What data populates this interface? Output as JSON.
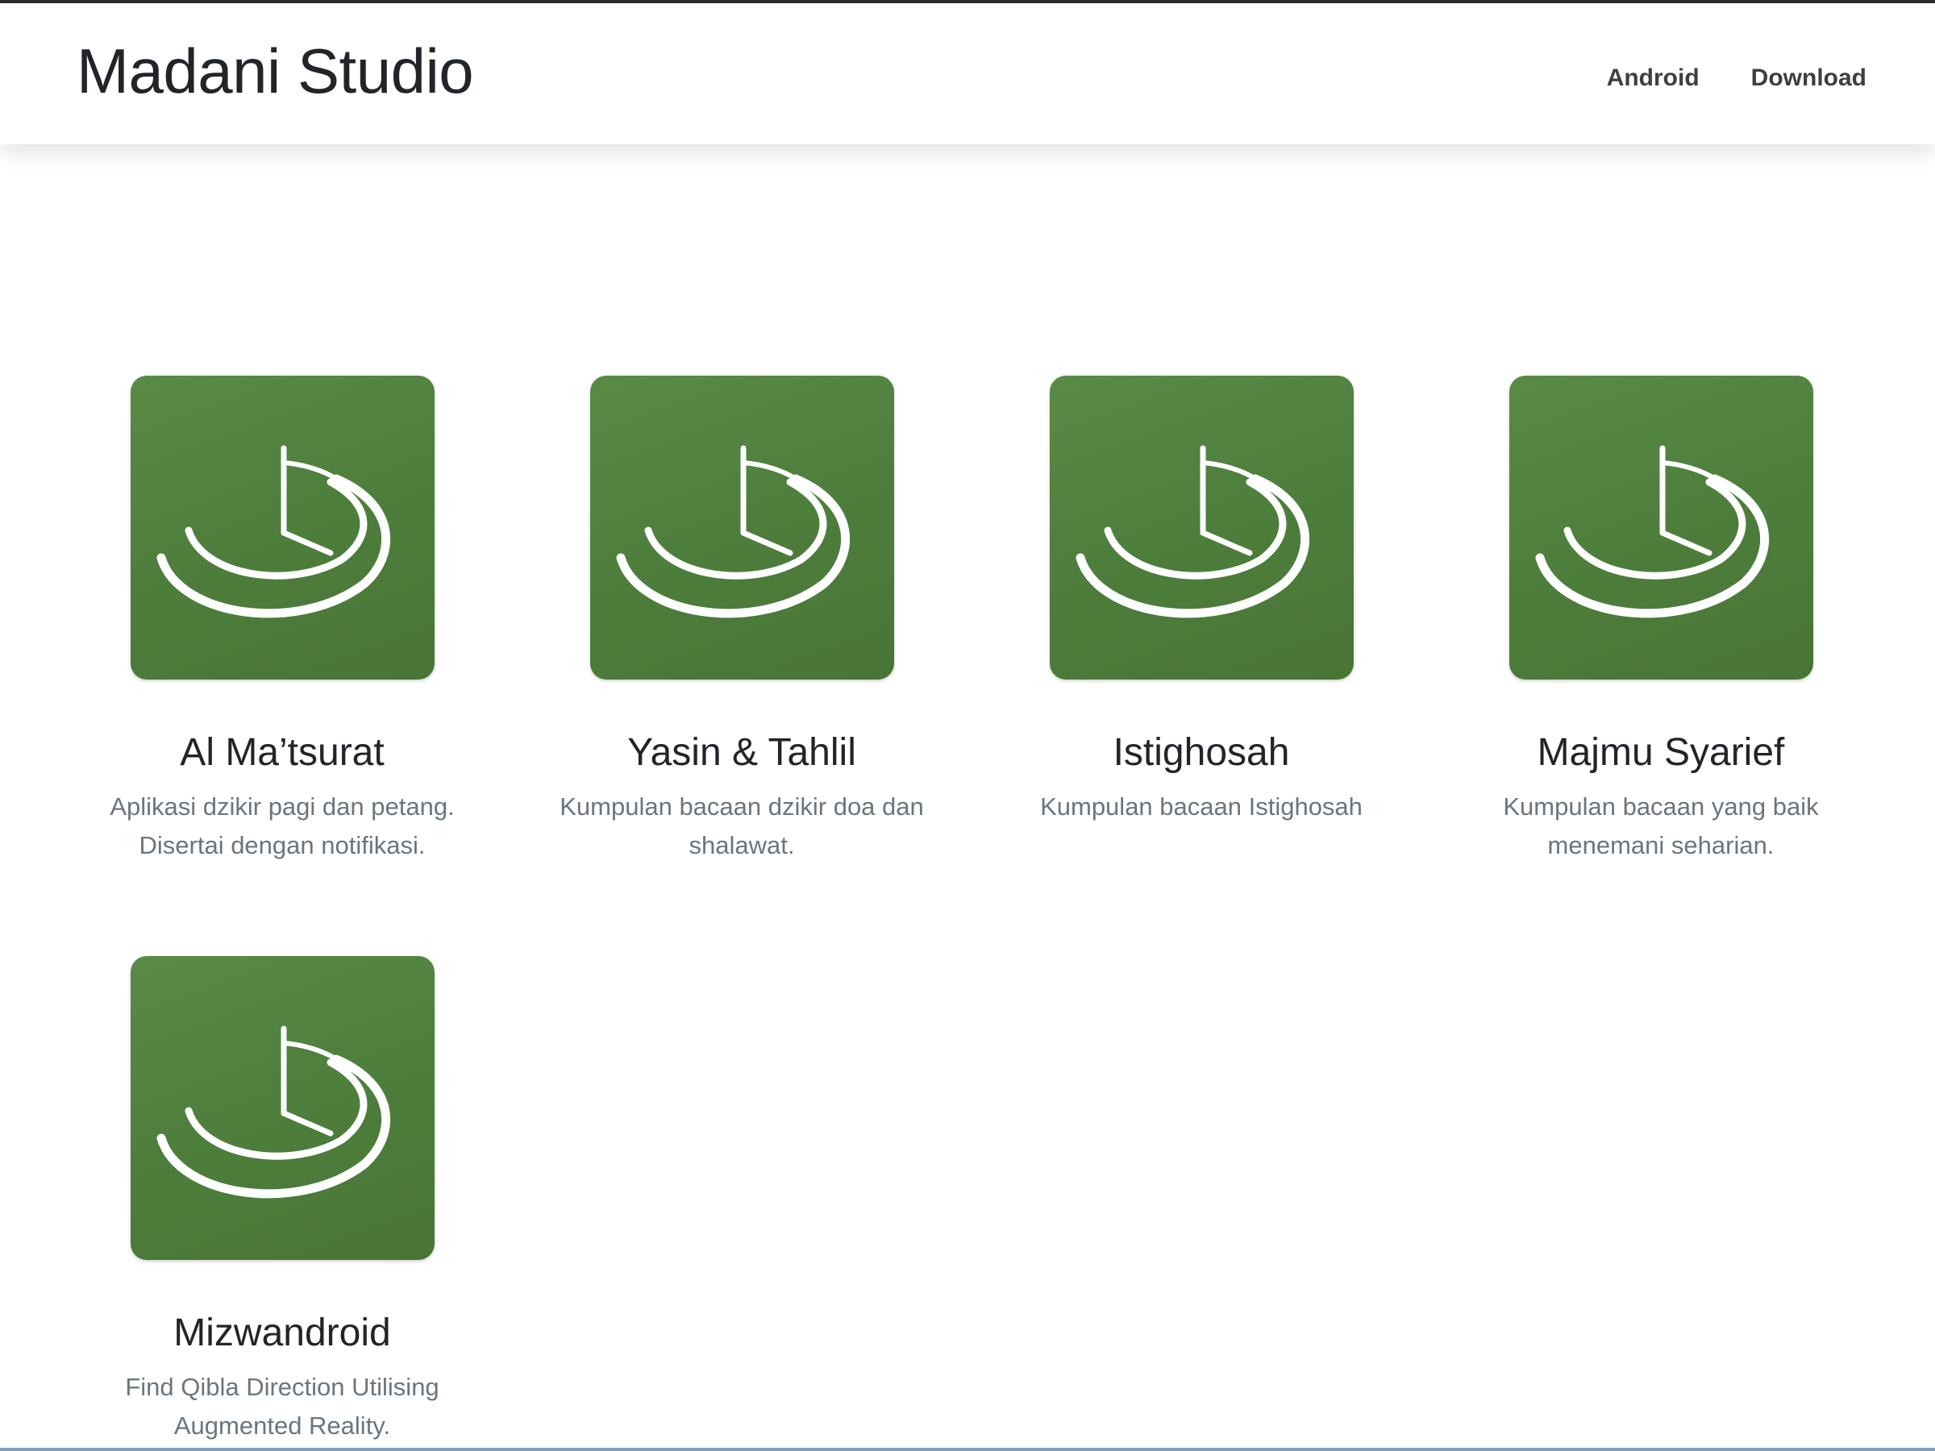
{
  "navbar": {
    "brand": "Madani Studio",
    "links": [
      {
        "label": "Android"
      },
      {
        "label": "Download"
      }
    ]
  },
  "apps": [
    {
      "title": "Al Ma’tsurat",
      "description": "Aplikasi dzikir pagi dan petang. Disertai dengan notifikasi.",
      "icon": "madani-logo-icon"
    },
    {
      "title": "Yasin & Tahlil",
      "description": "Kumpulan bacaan dzikir doa dan shalawat.",
      "icon": "madani-logo-icon"
    },
    {
      "title": "Istighosah",
      "description": "Kumpulan bacaan Istighosah",
      "icon": "madani-logo-icon"
    },
    {
      "title": "Majmu Syarief",
      "description": "Kumpulan bacaan yang baik menemani seharian.",
      "icon": "madani-logo-icon"
    },
    {
      "title": "Mizwandroid",
      "description": "Find Qibla Direction Utilising Augmented Reality.",
      "icon": "madani-logo-icon"
    }
  ],
  "colors": {
    "icon_green": "#4f803d",
    "text_dark": "#212529",
    "text_muted": "#6c757d"
  }
}
